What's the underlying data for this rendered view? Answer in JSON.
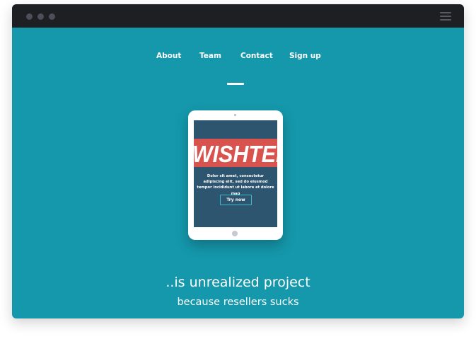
{
  "nav": {
    "items": [
      {
        "label": "About"
      },
      {
        "label": "Team"
      },
      {
        "label": "Contact"
      },
      {
        "label": "Sign up"
      }
    ]
  },
  "device": {
    "brand": "WISHTEK",
    "description": "Dolor sit amet, consectetur adipiscing elit, sed do eiusmod tempor incididunt ut labore et dolore mag",
    "cta_label": "Try now"
  },
  "hero": {
    "headline": "..is unrealized project",
    "subheadline": "because resellers sucks"
  },
  "colors": {
    "titlebar": "#1d1f23",
    "background": "#1598ac",
    "screen": "#2d5570",
    "banner": "#d8534d",
    "cta_border": "#3fb8c9"
  },
  "icons": {
    "window_controls": "traffic-light-dots",
    "menu": "hamburger-menu-icon"
  }
}
